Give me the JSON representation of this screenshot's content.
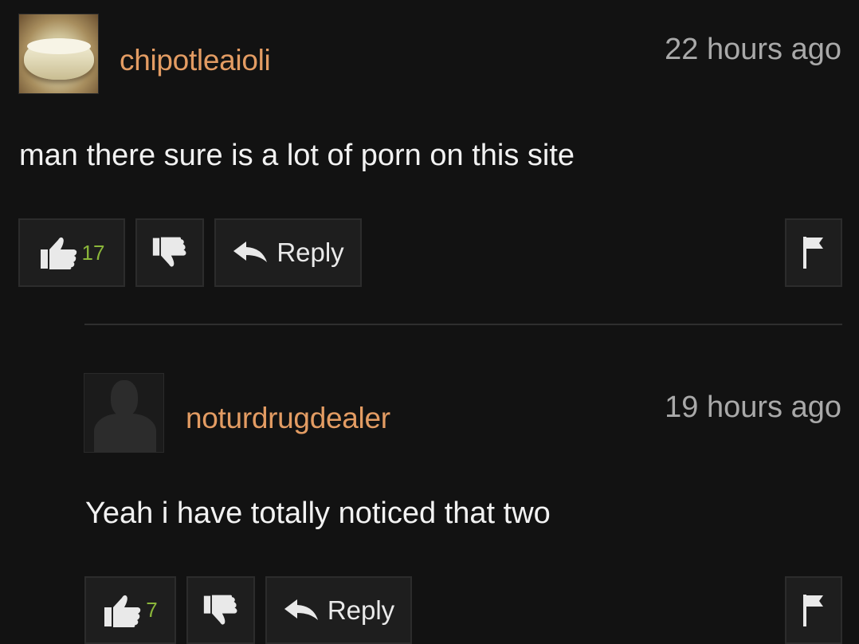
{
  "comments": [
    {
      "username": "chipotleaioli",
      "timestamp": "22 hours ago",
      "text": "man there sure is a lot of porn on this site",
      "likes": "17",
      "reply_label": "Reply",
      "avatar": "aioli-bowl-photo"
    },
    {
      "username": "noturdrugdealer",
      "timestamp": "19 hours ago",
      "text": "Yeah i have totally noticed that two",
      "likes": "7",
      "reply_label": "Reply",
      "avatar": "default-silhouette"
    }
  ],
  "icons": {
    "like": "thumbs-up-icon",
    "dislike": "thumbs-down-icon",
    "reply": "reply-arrow-icon",
    "flag": "flag-icon"
  },
  "colors": {
    "background": "#121212",
    "username": "#e39c63",
    "like_count": "#8bb63a",
    "timestamp": "#a9a9a9",
    "text": "#f2f2f2"
  }
}
